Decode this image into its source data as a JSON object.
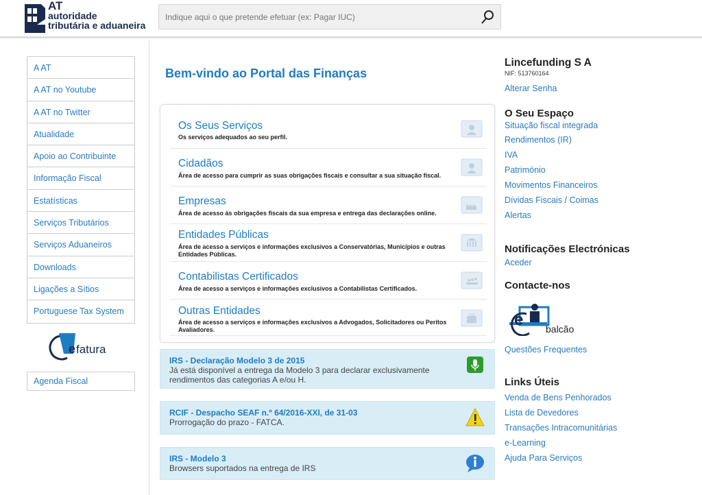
{
  "header": {
    "logo": {
      "line1": "AT",
      "line2": "autoridade",
      "line3": "tributária e aduaneira"
    },
    "search_placeholder": "Indique aqui o que pretende efetuar (ex: Pagar IUC)",
    "search_icon": "search-icon"
  },
  "sidebar": {
    "items": [
      {
        "label": "A AT"
      },
      {
        "label": "A AT no Youtube"
      },
      {
        "label": "A AT no Twitter"
      },
      {
        "label": "Atualidade"
      },
      {
        "label": "Apoio ao Contribuinte"
      },
      {
        "label": "Informação Fiscal"
      },
      {
        "label": "Estatísticas"
      },
      {
        "label": "Serviços Tributários"
      },
      {
        "label": "Serviços Aduaneiros"
      },
      {
        "label": "Downloads"
      },
      {
        "label": "Ligações a Sítios"
      },
      {
        "label": "Portuguese Tax System"
      }
    ],
    "efatura_logo": "efatura",
    "agenda": "Agenda Fiscal"
  },
  "main": {
    "title": "Bem-vindo ao Portal das Finanças",
    "services": [
      {
        "title": "Os Seus Serviços",
        "desc": "Os serviços adequados ao seu perfil.",
        "icon": "person-folder-icon"
      },
      {
        "title": "Cidadãos",
        "desc": "Área de acesso para cumprir as suas obrigações fiscais e consultar a sua situação fiscal.",
        "icon": "person-folder-icon"
      },
      {
        "title": "Empresas",
        "desc": "Área de acesso às obrigações fiscais da sua empresa e entrega das declarações online.",
        "icon": "factory-folder-icon"
      },
      {
        "title": "Entidades Públicas",
        "desc": "Área de acesso a serviços e informações exclusivos a Conservatórias, Municípios e outras Entidades Públicas.",
        "icon": "building-folder-icon"
      },
      {
        "title": "Contabilistas Certificados",
        "desc": "Área de acesso a serviços e informações exclusivos a Contabilistas Certificados.",
        "icon": "group-folder-icon"
      },
      {
        "title": "Outras Entidades",
        "desc": "Área de acesso a serviços e informações exclusivos a Advogados, Solicitadores ou Peritos Avaliadores.",
        "icon": "briefcase-folder-icon"
      }
    ],
    "alerts": [
      {
        "title": "IRS - Declaração Modelo 3 de 2015",
        "desc": "Já está disponível a entrega da Modelo 3 para declarar exclusivamente rendimentos das categorias A e/ou H.",
        "icon": "microphone-icon",
        "color": "#2e9a2e"
      },
      {
        "title": "RCIF - Despacho SEAF n.º 64/2016-XXI, de 31-03",
        "desc": "Prorrogação do prazo - FATCA.",
        "icon": "warning-icon",
        "color": "#f2d31b"
      },
      {
        "title": "IRS - Modelo 3",
        "desc": "Browsers suportados na entrega de IRS",
        "icon": "info-icon",
        "color": "#2f7fd0"
      }
    ]
  },
  "right": {
    "user": "Lincefunding S A",
    "nif": "NIF: 513760164",
    "change_password": "Alterar Senha",
    "space_title": "O Seu Espaço",
    "space_links": [
      "Situação fiscal integrada",
      "Rendimentos (IR)",
      "IVA",
      "Património",
      "Movimentos Financeiros",
      "Dívidas Fiscais / Coimas",
      "Alertas"
    ],
    "notif_title": "Notificações Electrónicas",
    "notif_link": "Aceder",
    "contact_title": "Contacte-nos",
    "ebalcao_logo": "e-balcão",
    "ebalcao_text": "balcão",
    "faq": "Questões Frequentes",
    "links_title": "Links Úteis",
    "links": [
      "Venda de Bens Penhorados",
      "Lista de Devedores",
      "Transações Intracomunitárias",
      "e-Learning",
      "Ajuda Para Serviços"
    ]
  },
  "colors": {
    "accent": "#1e7cc2",
    "link": "#2a7bbf",
    "alert_bg": "#d9edf7"
  }
}
